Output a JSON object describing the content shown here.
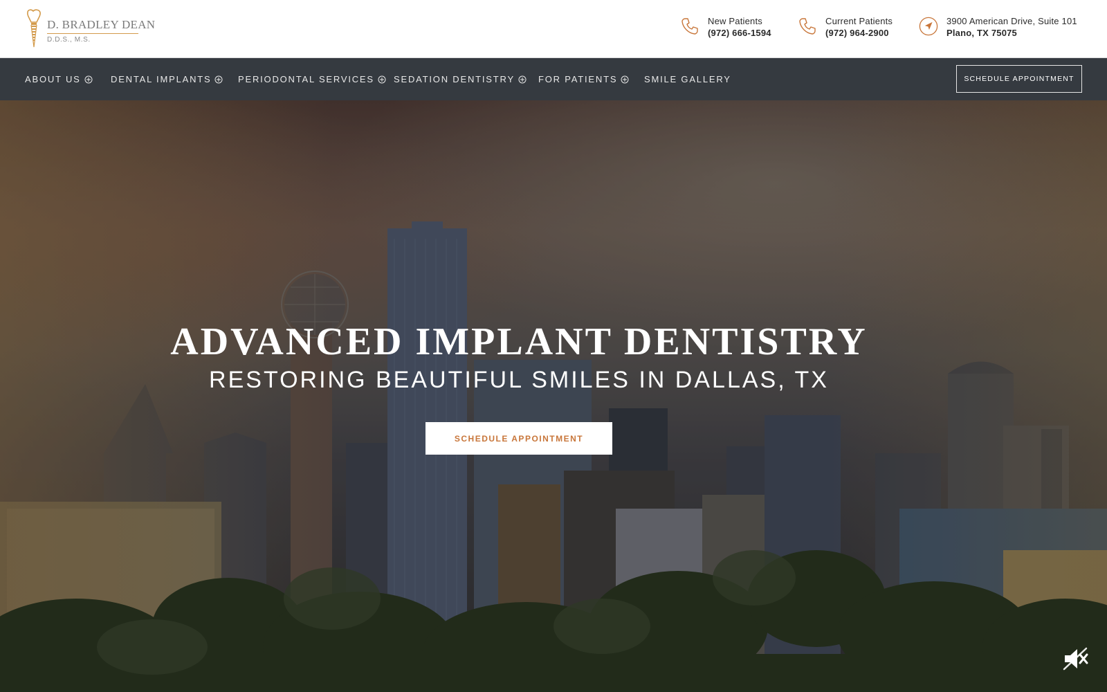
{
  "brand": {
    "name": "D. BRADLEY DEAN",
    "credentials": "D.D.S., M.S.",
    "logo_icon": "dental-implant-icon",
    "accent": "#c8763a",
    "gold": "#d39a4a"
  },
  "contacts": {
    "new_patients": {
      "label": "New Patients",
      "phone": "(972) 666-1594",
      "icon": "phone-icon"
    },
    "current_patients": {
      "label": "Current Patients",
      "phone": "(972) 964-2900",
      "icon": "phone-icon"
    },
    "address": {
      "line1": "3900 American Drive, Suite 101",
      "line2": "Plano, TX 75075",
      "icon": "location-arrow-icon"
    }
  },
  "nav": {
    "items": [
      {
        "label": "ABOUT US",
        "has_submenu": true
      },
      {
        "label": "DENTAL IMPLANTS",
        "has_submenu": true
      },
      {
        "label": "PERIODONTAL SERVICES",
        "has_submenu": true
      },
      {
        "label": "SEDATION DENTISTRY",
        "has_submenu": true
      },
      {
        "label": "FOR PATIENTS",
        "has_submenu": true
      },
      {
        "label": "SMILE GALLERY",
        "has_submenu": false
      }
    ],
    "cta_label": "SCHEDULE APPOINTMENT",
    "background": "#353a40"
  },
  "hero": {
    "title": "ADVANCED IMPLANT DENTISTRY",
    "subtitle": "RESTORING BEAUTIFUL SMILES IN DALLAS, TX",
    "cta_label": "SCHEDULE APPOINTMENT",
    "mute_icon": "speaker-muted-icon"
  }
}
